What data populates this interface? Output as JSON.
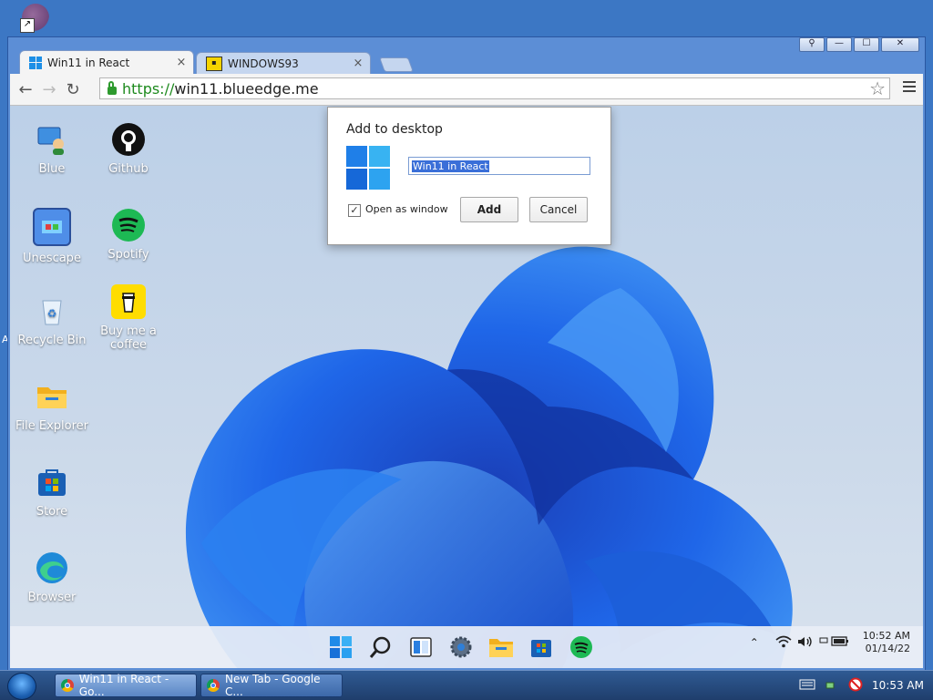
{
  "host": {
    "edge_label": "A",
    "taskbar": {
      "buttons": [
        {
          "label": "Win11 in React - Go..."
        },
        {
          "label": "New Tab - Google C..."
        }
      ],
      "clock": "10:53 AM"
    }
  },
  "browser": {
    "controls": {
      "profile": "⚲",
      "minimize": "—",
      "maximize": "☐",
      "close": "✕"
    },
    "tabs": [
      {
        "title": "Win11 in React",
        "close": "×"
      },
      {
        "title": "WINDOWS93",
        "close": "×"
      }
    ],
    "address": {
      "scheme": "https://",
      "host": "win11.blueedge.me"
    }
  },
  "dialog": {
    "title": "Add to desktop",
    "name_value": "Win11 in React",
    "open_as_window_label": "Open as window",
    "open_as_window_checked": true,
    "add_label": "Add",
    "cancel_label": "Cancel"
  },
  "desktop_icons": [
    {
      "label": "Blue",
      "icon": "blue-user-icon"
    },
    {
      "label": "Github",
      "icon": "github-icon"
    },
    {
      "label": "Unescape",
      "icon": "unescape-icon"
    },
    {
      "label": "Spotify",
      "icon": "spotify-icon"
    },
    {
      "label": "Recycle Bin",
      "icon": "recycle-bin-icon"
    },
    {
      "label": "Buy me a coffee",
      "icon": "coffee-icon"
    },
    {
      "label": "File Explorer",
      "icon": "folder-icon"
    },
    {
      "label": "Store",
      "icon": "store-icon"
    },
    {
      "label": "Browser",
      "icon": "edge-icon"
    }
  ],
  "win11_taskbar": {
    "icons": [
      "start-icon",
      "search-icon",
      "widgets-icon",
      "settings-icon",
      "file-explorer-icon",
      "store-icon",
      "spotify-icon"
    ],
    "tray_chevron": "⌃",
    "time": "10:52 AM",
    "date": "01/14/22"
  },
  "colors": {
    "accent": "#1d6fe0",
    "spotify": "#1db954",
    "host_taskbar": "#2a4f86"
  }
}
